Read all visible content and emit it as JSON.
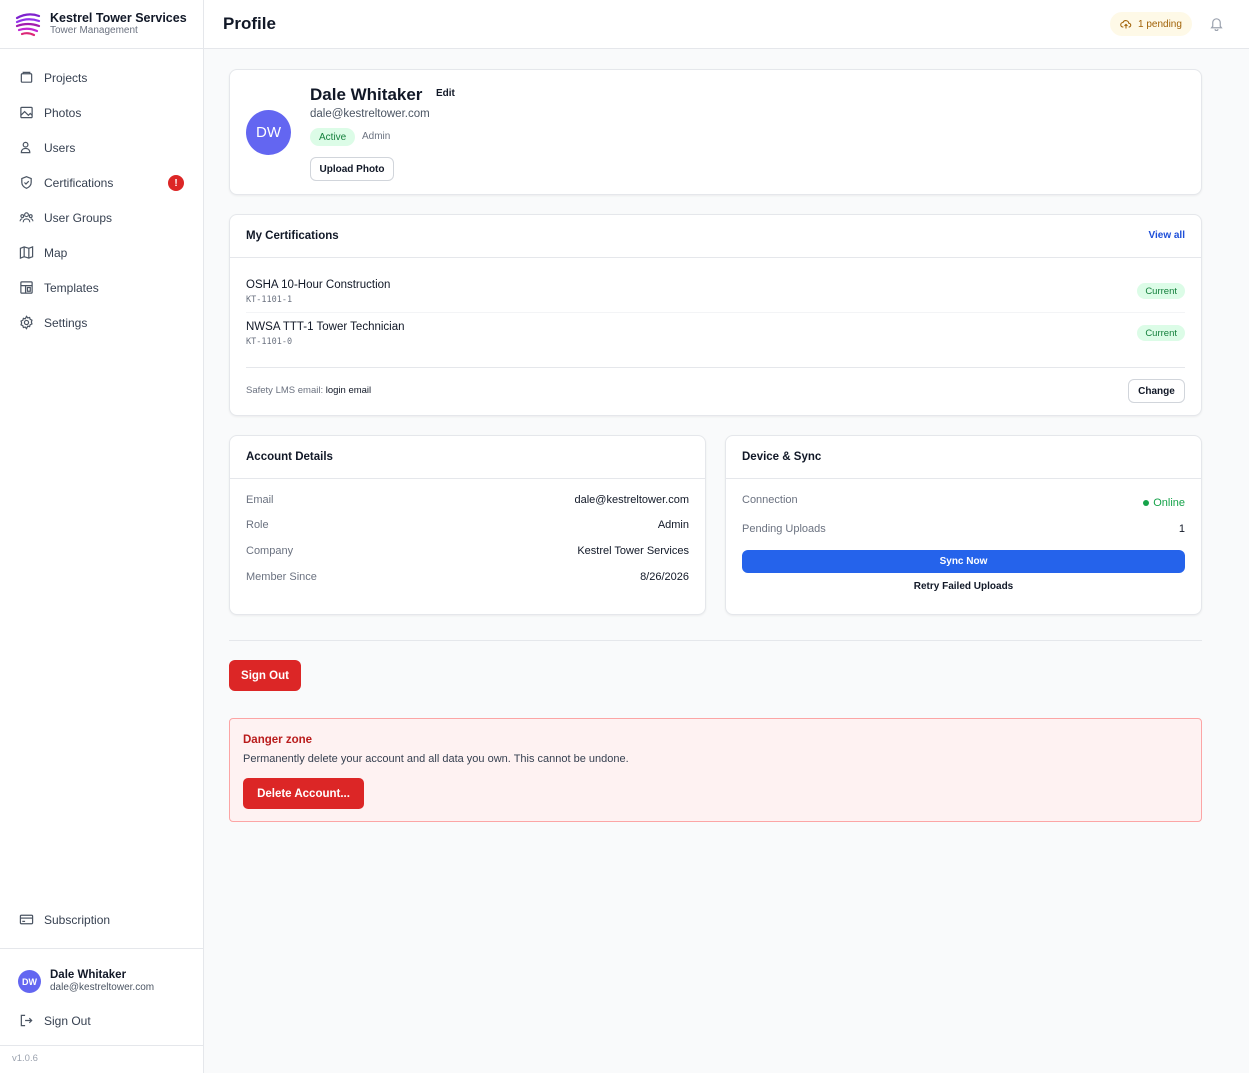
{
  "brand": {
    "name": "Kestrel Tower Services",
    "subtitle": "Tower Management"
  },
  "sidebar": {
    "items": [
      {
        "label": "Projects",
        "icon": "folder-icon"
      },
      {
        "label": "Photos",
        "icon": "image-icon"
      },
      {
        "label": "Users",
        "icon": "users-icon"
      },
      {
        "label": "Certifications",
        "icon": "shield-check-icon",
        "badge": "!"
      },
      {
        "label": "User Groups",
        "icon": "user-groups-icon"
      },
      {
        "label": "Map",
        "icon": "map-icon"
      },
      {
        "label": "Templates",
        "icon": "template-icon"
      },
      {
        "label": "Settings",
        "icon": "gear-icon"
      }
    ],
    "subscription_label": "Subscription",
    "user": {
      "initials": "DW",
      "name": "Dale Whitaker",
      "email": "dale@kestreltower.com"
    },
    "sign_out_label": "Sign Out",
    "version": "v1.0.6"
  },
  "header": {
    "title": "Profile",
    "pending_label": "1 pending"
  },
  "profile": {
    "initials": "DW",
    "name": "Dale Whitaker",
    "edit_label": "Edit",
    "email": "dale@kestreltower.com",
    "status": "Active",
    "role": "Admin",
    "upload_label": "Upload Photo"
  },
  "certifications": {
    "title": "My Certifications",
    "view_all_label": "View all",
    "items": [
      {
        "name": "OSHA 10-Hour Construction",
        "id": "KT-1101-1",
        "status": "Current"
      },
      {
        "name": "NWSA TTT-1 Tower Technician",
        "id": "KT-1101-0",
        "status": "Current"
      }
    ],
    "lms_label": "Safety LMS email:",
    "lms_value": "login email",
    "change_label": "Change"
  },
  "account": {
    "title": "Account Details",
    "rows": [
      {
        "key": "Email",
        "value": "dale@kestreltower.com"
      },
      {
        "key": "Role",
        "value": "Admin"
      },
      {
        "key": "Company",
        "value": "Kestrel Tower Services"
      },
      {
        "key": "Member Since",
        "value": "8/26/2026"
      }
    ]
  },
  "sync": {
    "title": "Device & Sync",
    "connection_label": "Connection",
    "connection_value": "Online",
    "pending_label": "Pending Uploads",
    "pending_value": "1",
    "sync_now_label": "Sync Now",
    "retry_label": "Retry Failed Uploads"
  },
  "sign_out_label": "Sign Out",
  "danger": {
    "title": "Danger zone",
    "text": "Permanently delete your account and all data you own. This cannot be undone.",
    "delete_label": "Delete Account..."
  },
  "colors": {
    "primary": "#2563eb",
    "danger": "#dc2626",
    "success": "#16a34a",
    "avatar": "#6366f1"
  }
}
